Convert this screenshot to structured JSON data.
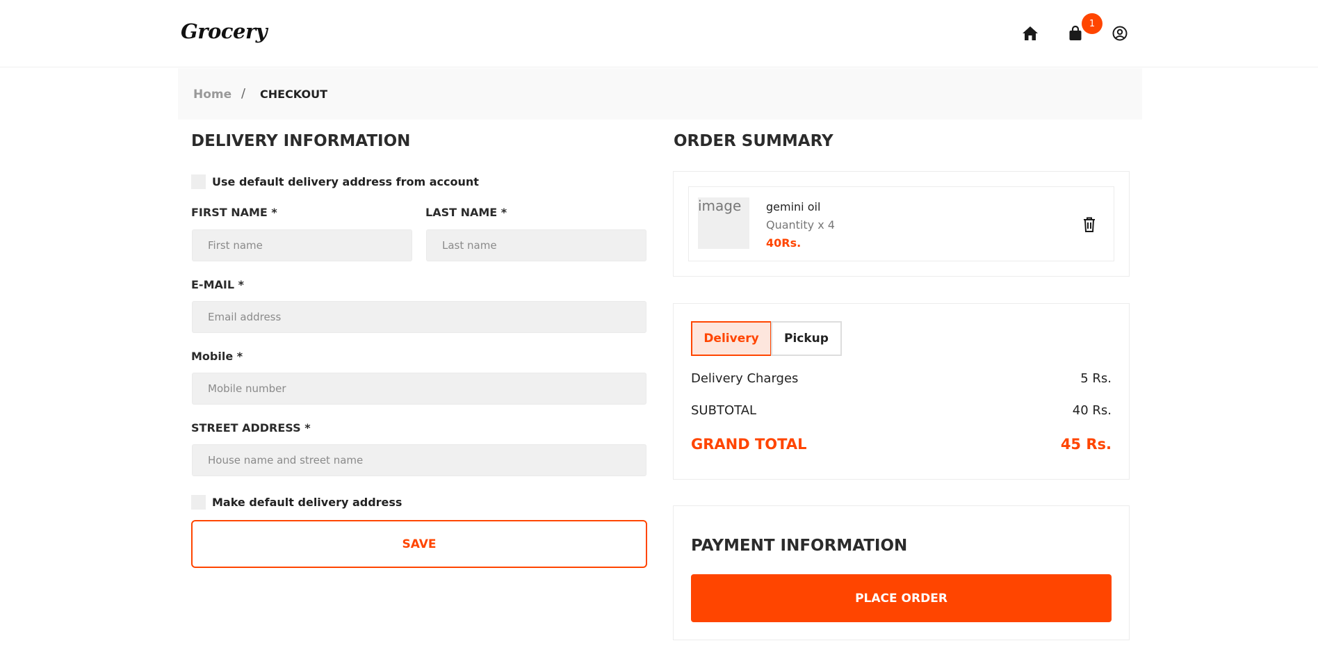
{
  "header": {
    "logo": "Grocery",
    "cart_count": "1",
    "icons": [
      "home-icon",
      "shopping-bag-icon",
      "user-circle-icon"
    ]
  },
  "breadcrumb": {
    "home": "Home",
    "separator": "/",
    "current": "CHECKOUT"
  },
  "delivery": {
    "title": "DELIVERY INFORMATION",
    "use_default_label": "Use default delivery address from account",
    "first_name_label": "FIRST NAME *",
    "first_name_placeholder": "First name",
    "first_name_value": "",
    "last_name_label": "LAST NAME *",
    "last_name_placeholder": "Last name",
    "last_name_value": "",
    "email_label": "E-MAIL *",
    "email_placeholder": "Email address",
    "email_value": "",
    "mobile_label": "Mobile *",
    "mobile_placeholder": "Mobile number",
    "mobile_value": "",
    "street_label": "STREET ADDRESS *",
    "street_placeholder": "House name and street name",
    "street_value": "",
    "make_default_label": "Make default delivery address",
    "save_label": "SAVE"
  },
  "summary": {
    "title": "ORDER SUMMARY",
    "items": [
      {
        "image_alt": "image",
        "name": "gemini oil",
        "quantity": "Quantity x 4",
        "price": "40Rs."
      }
    ],
    "tabs": {
      "delivery": "Delivery",
      "pickup": "Pickup",
      "selected": "Delivery"
    },
    "delivery_charges_label": "Delivery Charges",
    "delivery_charges_value": "5 Rs.",
    "subtotal_label": "SUBTOTAL",
    "subtotal_value": "40 Rs.",
    "grand_total_label": "GRAND TOTAL",
    "grand_total_value": "45 Rs."
  },
  "payment": {
    "title": "PAYMENT INFORMATION",
    "place_order_label": "PLACE ORDER"
  },
  "colors": {
    "accent": "#ff4500",
    "input_bg": "#f0f0f0",
    "tab_selected_bg": "#fde6dd"
  }
}
